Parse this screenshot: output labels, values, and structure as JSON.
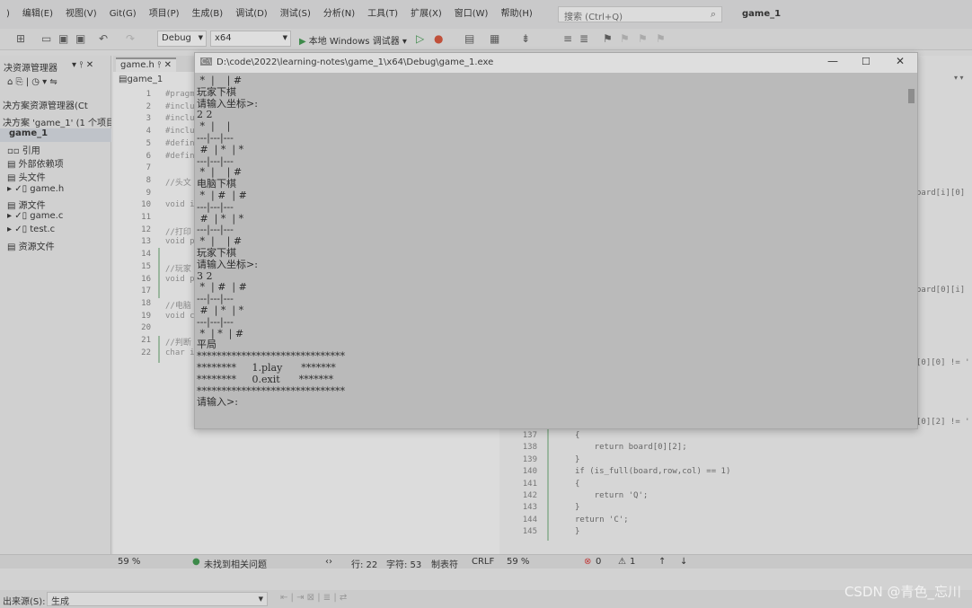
{
  "menubar": {
    "items": [
      "编辑(E)",
      "视图(V)",
      "Git(G)",
      "项目(P)",
      "生成(B)",
      "调试(D)",
      "测试(S)",
      "分析(N)",
      "工具(T)",
      "扩展(X)",
      "窗口(W)",
      "帮助(H)"
    ],
    "search_placeholder": "搜索 (Ctrl+Q)",
    "window_title": "game_1"
  },
  "toolbar": {
    "config": "Debug",
    "platform": "x64",
    "run_label": "本地 Windows 调试器"
  },
  "solution_explorer": {
    "title": "决资源管理器",
    "search_placeholder": "决方案资源管理器(Ct",
    "solution_label": "决方案 'game_1' (1 个项目",
    "project": "game_1",
    "items": [
      "引用",
      "外部依赖项",
      "头文件",
      "game.h",
      "源文件",
      "game.c",
      "test.c",
      "资源文件"
    ]
  },
  "editor": {
    "tab_label": "game.h",
    "nav_label": "game_1",
    "lines": [
      {
        "n": "1",
        "t": "#pragma once"
      },
      {
        "n": "2",
        "t": "#include"
      },
      {
        "n": "3",
        "t": "#include"
      },
      {
        "n": "4",
        "t": "#include"
      },
      {
        "n": "5",
        "t": "#define"
      },
      {
        "n": "6",
        "t": "#define"
      },
      {
        "n": "7",
        "t": ""
      },
      {
        "n": "8",
        "t": "//头文"
      },
      {
        "n": "9",
        "t": ""
      },
      {
        "n": "10",
        "t": "void i"
      },
      {
        "n": "11",
        "t": ""
      },
      {
        "n": "12",
        "t": "//打印"
      },
      {
        "n": "13",
        "t": "void p"
      },
      {
        "n": "14",
        "t": ""
      },
      {
        "n": "15",
        "t": "//玩家"
      },
      {
        "n": "16",
        "t": "void p"
      },
      {
        "n": "17",
        "t": ""
      },
      {
        "n": "18",
        "t": "//电脑"
      },
      {
        "n": "19",
        "t": "void c"
      },
      {
        "n": "20",
        "t": ""
      },
      {
        "n": "21",
        "t": "//判断"
      },
      {
        "n": "22",
        "t": "char i"
      }
    ],
    "zoom": "59 %",
    "status_ok": "未找到相关问题",
    "line": "行: 22",
    "char": "字符: 53",
    "tabs_mode": "制表符",
    "eol": "CRLF"
  },
  "right_editor": {
    "fragments": [
      "oard[i][0]",
      "oard[0][i]",
      "[0][0] != '",
      "[0][2] != '"
    ],
    "lines": [
      {
        "n": "137",
        "t": "{"
      },
      {
        "n": "138",
        "t": "    return board[0][2];"
      },
      {
        "n": "139",
        "t": "}"
      },
      {
        "n": "140",
        "t": "if (is_full(board,row,col) == 1)"
      },
      {
        "n": "141",
        "t": "{"
      },
      {
        "n": "142",
        "t": "    return 'Q';"
      },
      {
        "n": "143",
        "t": "}"
      },
      {
        "n": "144",
        "t": "return 'C';"
      },
      {
        "n": "145",
        "t": "}"
      }
    ],
    "zoom": "59 %",
    "errors": "0",
    "warnings": "1"
  },
  "console": {
    "title": "D:\\code\\2022\\learning-notes\\game_1\\x64\\Debug\\game_1.exe",
    "lines": [
      " *  |    | #",
      "玩家下棋",
      "请输入坐标>:",
      "2 2",
      " *  |    |",
      "---|---|---",
      " #  | *  | *",
      "---|---|---",
      " *  |    | #",
      "电脑下棋",
      " *  | #  | #",
      "---|---|---",
      " #  | *  | *",
      "---|---|---",
      " *  |    | #",
      "玩家下棋",
      "请输入坐标>:",
      "3 2",
      " *  | #  | #",
      "---|---|---",
      " #  | *  | *",
      "---|---|---",
      " *  | *  | #",
      "平局",
      "******************************",
      "********     1.play      *******",
      "********     0.exit      *******",
      "******************************",
      "请输入>:"
    ]
  },
  "output": {
    "label": "出来源(S):",
    "value": "生成"
  },
  "watermark": "CSDN @青色_忘川"
}
